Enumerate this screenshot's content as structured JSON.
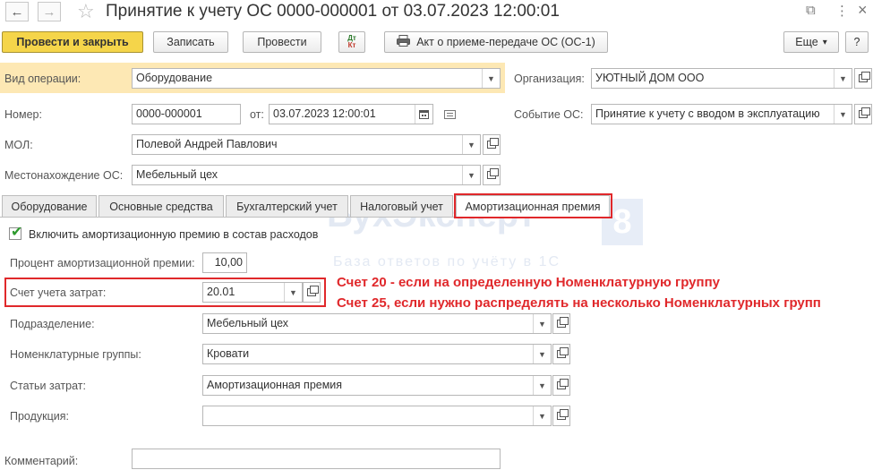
{
  "title": "Принятие к учету ОС 0000-000001 от 03.07.2023 12:00:01",
  "nav": {
    "back": "←",
    "forward": "→",
    "favorite": "☆",
    "link": "⧉",
    "menu": "⋮",
    "close": "×"
  },
  "toolbar": {
    "post_close": "Провести и закрыть",
    "save": "Записать",
    "post": "Провести",
    "dtkt_top": "Дт",
    "dtkt_bottom": "Кт",
    "act": "Акт о приеме-передаче ОС (ОС-1)",
    "more": "Еще",
    "more_arrow": "▾",
    "help": "?"
  },
  "form": {
    "operation_label": "Вид операции:",
    "operation_value": "Оборудование",
    "organization_label": "Организация:",
    "organization_value": "УЮТНЫЙ ДОМ ООО",
    "number_label": "Номер:",
    "number_value": "0000-000001",
    "date_label": "от:",
    "date_value": "03.07.2023 12:00:01",
    "event_label": "Событие ОС:",
    "event_value": "Принятие к учету с вводом в эксплуатацию",
    "mol_label": "МОЛ:",
    "mol_value": "Полевой Андрей Павлович",
    "location_label": "Местонахождение ОС:",
    "location_value": "Мебельный цех",
    "comment_label": "Комментарий:",
    "comment_value": ""
  },
  "tabs": [
    "Оборудование",
    "Основные средства",
    "Бухгалтерский учет",
    "Налоговый учет",
    "Амортизационная премия"
  ],
  "premium": {
    "include_label": "Включить амортизационную премию в состав расходов",
    "include_checked": true,
    "percent_label": "Процент амортизационной премии:",
    "percent_value": "10,00",
    "account_label": "Счет учета затрат:",
    "account_value": "20.01",
    "division_label": "Подразделение:",
    "division_value": "Мебельный цех",
    "nomgroup_label": "Номенклатурные группы:",
    "nomgroup_value": "Кровати",
    "costitem_label": "Статьи затрат:",
    "costitem_value": "Амортизационная премия",
    "product_label": "Продукция:",
    "product_value": ""
  },
  "annotations": {
    "line1": "Счет 20 - если на определенную Номенклатурную группу",
    "line2": "Счет 25, если нужно распределять на несколько Номенклатурных групп"
  },
  "watermark": {
    "brand": "БухЭксперт",
    "digit": "8",
    "tagline": "База ответов по учёту в 1С"
  },
  "colors": {
    "accent": "#f5d54a",
    "highlight": "#fde8b4",
    "annotation": "#e0282b",
    "check": "#2e9a2e"
  }
}
